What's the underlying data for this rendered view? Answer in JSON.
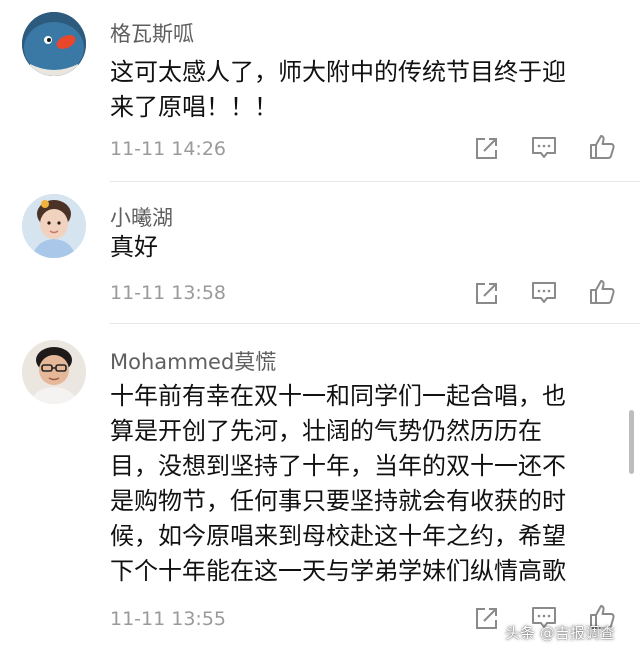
{
  "comments": [
    {
      "username": "格瓦斯呱",
      "lines": [
        "这可太感人了，师大附中的传统节目终于迎",
        "来了原唱！！！"
      ],
      "time": "11-11 14:26",
      "avatar_icon": "blue-cartoon-avatar"
    },
    {
      "username": "小曦湖",
      "lines": [
        "真好"
      ],
      "time": "11-11 13:58",
      "avatar_icon": "child-photo-avatar"
    },
    {
      "username": "Mohammed莫慌",
      "lines": [
        "十年前有幸在双十一和同学们一起合唱，也",
        "算是开创了先河，壮阔的气势仍然历历在",
        "目，没想到坚持了十年，当年的双十一还不",
        "是购物节，任何事只要坚持就会有收获的时",
        "候，如今原唱来到母校赴这十年之约，希望",
        "下个十年能在这一天与学弟学妹们纵情高歌"
      ],
      "time": "11-11 13:55",
      "avatar_icon": "man-photo-avatar"
    }
  ],
  "actions": {
    "share_icon": "share-icon",
    "reply_icon": "comment-icon",
    "like_icon": "thumbs-up-icon"
  },
  "watermark": "头条 @吉报调查",
  "colors": {
    "username": "#5f5f5f",
    "text": "#111111",
    "time": "#9a9a9a",
    "icon": "#8a8a8a",
    "divider": "#e6e6e6"
  }
}
